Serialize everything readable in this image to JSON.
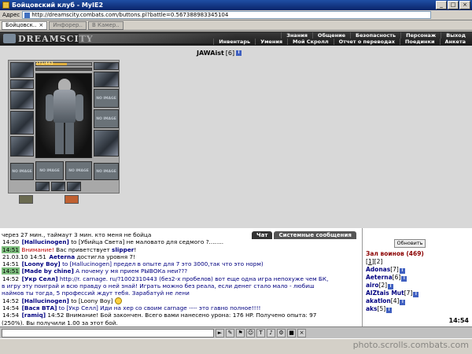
{
  "window": {
    "title": "Бойцовский клуб - MyIE2"
  },
  "address": {
    "label": "Адрес",
    "url": "http://dreamscity.combats.com/buttons.pl?battle=0.567388983345104"
  },
  "tabs": [
    {
      "label": "Бойцовск..",
      "active": true
    },
    {
      "label": "Инфорер..",
      "active": false
    },
    {
      "label": "В Камер..",
      "active": false
    }
  ],
  "header": {
    "logo": "DREAMSCITY",
    "nav_row1": [
      "Знания",
      "Общение",
      "Безопасность",
      "Персонаж",
      "Выход"
    ],
    "nav_row2": [
      "Инвентарь",
      "Умения",
      "Мой Скролл",
      "Отчет о переводах",
      "Поединки",
      "Анкета"
    ]
  },
  "character": {
    "name": "JAWAist",
    "level": "[6]",
    "hp_text": "271/443",
    "hp_fraction": 0.55,
    "no_image": "NO IMAGE"
  },
  "chat": {
    "tabs": [
      "Чат",
      "Системные сообщения"
    ],
    "lines": [
      {
        "parts": [
          {
            "text": "через 27 мин., таймаут 3 мин. кто меня не бойца",
            "cls": ""
          }
        ]
      },
      {
        "parts": [
          {
            "text": "14:50",
            "cls": "t plain"
          },
          {
            "text": " [Hallucinogen]",
            "cls": "u"
          },
          {
            "text": " to [Убийца Света] не маловато для седмого ?........",
            "cls": ""
          }
        ]
      },
      {
        "parts": [
          {
            "text": "14:51",
            "cls": "t"
          },
          {
            "text": " Внимание!",
            "cls": "warn"
          },
          {
            "text": " Вас приветствует ",
            "cls": ""
          },
          {
            "text": "slipper",
            "cls": "u"
          },
          {
            "text": "!",
            "cls": ""
          }
        ]
      },
      {
        "parts": [
          {
            "text": "21.03.10 14:51",
            "cls": "t plain"
          },
          {
            "text": " Aeterna",
            "cls": "u"
          },
          {
            "text": " достигла уровня 7!",
            "cls": ""
          }
        ]
      },
      {
        "parts": [
          {
            "text": "14:51",
            "cls": "t plain"
          },
          {
            "text": " [Loony Boy]",
            "cls": "u"
          },
          {
            "text": " to [Hallucinogen] предел в опыте для 7 это 3000,так что это норм)",
            "cls": "msg-blue"
          }
        ]
      },
      {
        "parts": [
          {
            "text": "14:51",
            "cls": "t"
          },
          {
            "text": " [Made by chine]",
            "cls": "u"
          },
          {
            "text": " А почему у мя прием РЫВОКа неи???",
            "cls": "msg-blue"
          }
        ]
      },
      {
        "parts": [
          {
            "text": "14:52",
            "cls": "t plain"
          },
          {
            "text": " [Укр Селл]",
            "cls": "u"
          },
          {
            "text": " http://r. carnage. ru/?1002310443 (без2-х пробелов) вот еще одна игра непохуже чем БК,",
            "cls": "msg-blue"
          }
        ]
      },
      {
        "parts": [
          {
            "text": "в игру эту поиграй и всю правду о ней знай! Играть можно без реала, если денег стало мало - любиш",
            "cls": "msg-blue"
          }
        ]
      },
      {
        "parts": [
          {
            "text": "наймов ты тогда, 5 профессий ждут тебя. Зарабатуй не лени",
            "cls": "msg-blue"
          }
        ]
      },
      {
        "parts": [
          {
            "text": "14:52",
            "cls": "t plain"
          },
          {
            "text": " [Hallucinogen]",
            "cls": "u"
          },
          {
            "text": " to [Loony Boy] ",
            "cls": ""
          },
          {
            "text": "",
            "cls": "emoji"
          }
        ]
      },
      {
        "parts": [
          {
            "text": "14:54",
            "cls": "t plain"
          },
          {
            "text": " [Вася ВТА]",
            "cls": "u"
          },
          {
            "text": " to [Укр Селл] Иди на хер со своим carnage ---- это гавно полное!!!!",
            "cls": "msg-blue"
          }
        ]
      },
      {
        "parts": [
          {
            "text": "14:54",
            "cls": "t plain"
          },
          {
            "text": " [ramiq]",
            "cls": "u"
          },
          {
            "text": " 14:52 Внимание! Бой закончен. Всего вами нанесено урона: 176 HP. Получено опыта: 97",
            "cls": ""
          }
        ]
      },
      {
        "parts": [
          {
            "text": "(250%). Вы получили 1.00 за этот бой.",
            "cls": ""
          }
        ]
      }
    ]
  },
  "room": {
    "refresh_label": "Обновить",
    "title": "Зал воинов (469)",
    "pages": [
      "1",
      "2"
    ],
    "warriors": [
      {
        "name": "Adonas",
        "level": "[7]"
      },
      {
        "name": "Aeterna",
        "level": "[6]"
      },
      {
        "name": "airo",
        "level": "[2]"
      },
      {
        "name": "AIZtais Mut",
        "level": "[7]"
      },
      {
        "name": "akatlon",
        "level": "[4]"
      },
      {
        "name": "aks",
        "level": "[5]"
      }
    ],
    "clock": "14:54"
  },
  "watermark": "photo.scrolls.combats.com"
}
